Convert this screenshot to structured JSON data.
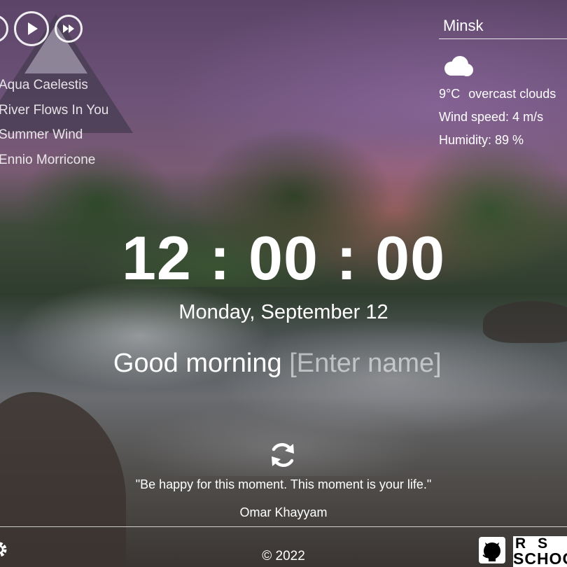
{
  "player": {
    "controls": [
      "previous",
      "play",
      "next"
    ],
    "playlist": [
      "Aqua Caelestis",
      "River Flows In You",
      "Summer Wind",
      "Ennio Morricone"
    ]
  },
  "weather": {
    "city": "Minsk",
    "icon": "cloud-icon",
    "temperature": "9°C",
    "description": "overcast clouds",
    "wind": "Wind speed: 4 m/s",
    "humidity": "Humidity: 89 %"
  },
  "clock": {
    "time": "12 : 00 : 00",
    "date": "Monday, September 12"
  },
  "greeting": {
    "text": "Good morning",
    "name_placeholder": "[Enter name]"
  },
  "quote": {
    "text": "\"Be happy for this moment. This moment is your life.\"",
    "author": "Omar Khayyam"
  },
  "footer": {
    "copyright": "© 2022",
    "logo_text": "RS SCHOOL"
  }
}
